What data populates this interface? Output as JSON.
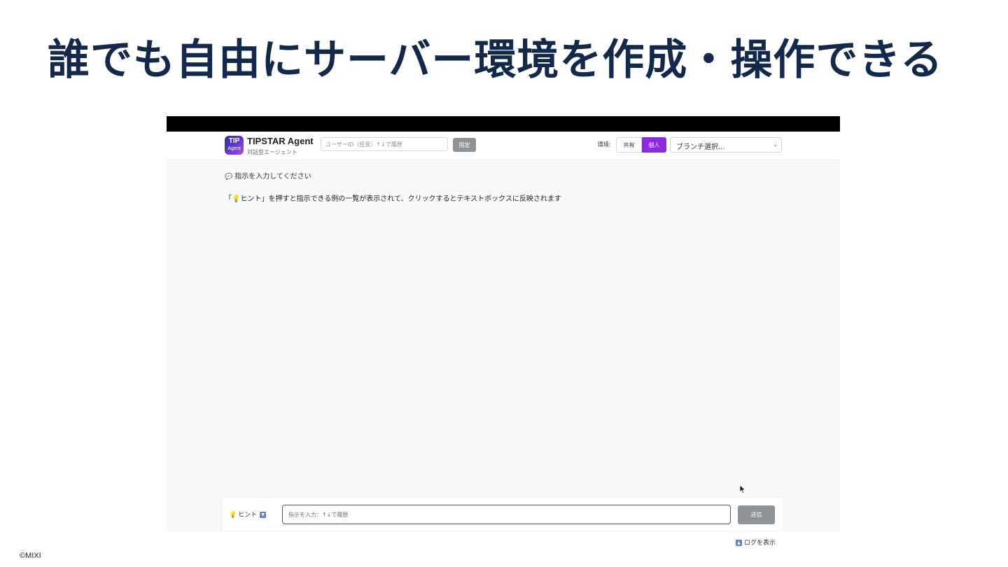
{
  "slide": {
    "title": "誰でも自由にサーバー環境を作成・操作できる",
    "copyright": "©MIXI"
  },
  "app": {
    "logo_top": "TIP",
    "logo_bottom": "Agent",
    "name": "TIPSTAR Agent",
    "subtitle": "対話型エージェント",
    "user_id_placeholder": "ユーザーID（任意）↑↓で履歴",
    "fix_button": "固定",
    "env_label": "環境:",
    "env_shared": "共有",
    "env_personal": "個人",
    "branch_select_value": "ブランチ選択...",
    "active_env_color": "#8a2be2"
  },
  "chat": {
    "prompt": "指示を入力してください",
    "hint": "「💡ヒント」を押すと指示できる例の一覧が表示されて、クリックするとテキストボックスに反映されます"
  },
  "input_bar": {
    "hint_label": "ヒント",
    "message_placeholder": "指示を入力：↑↓で履歴",
    "send_button": "送信"
  },
  "footer": {
    "log_toggle": "ログを表示"
  }
}
